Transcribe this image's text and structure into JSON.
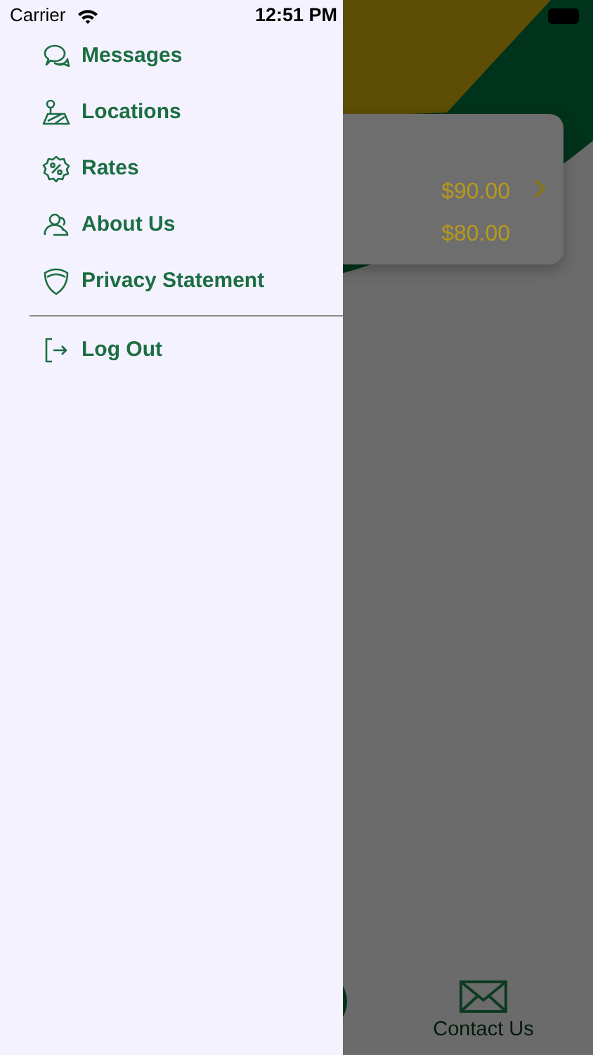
{
  "status_bar": {
    "carrier": "Carrier",
    "time": "12:51 PM"
  },
  "menu": [
    {
      "label": "Messages"
    },
    {
      "label": "Locations"
    },
    {
      "label": "Rates"
    },
    {
      "label": "About Us"
    },
    {
      "label": "Privacy Statement"
    }
  ],
  "logout": {
    "label": "Log Out"
  },
  "card": {
    "prices": [
      "$90.00",
      "$80.00"
    ]
  },
  "tab_bar": {
    "label": "Contact Us"
  }
}
